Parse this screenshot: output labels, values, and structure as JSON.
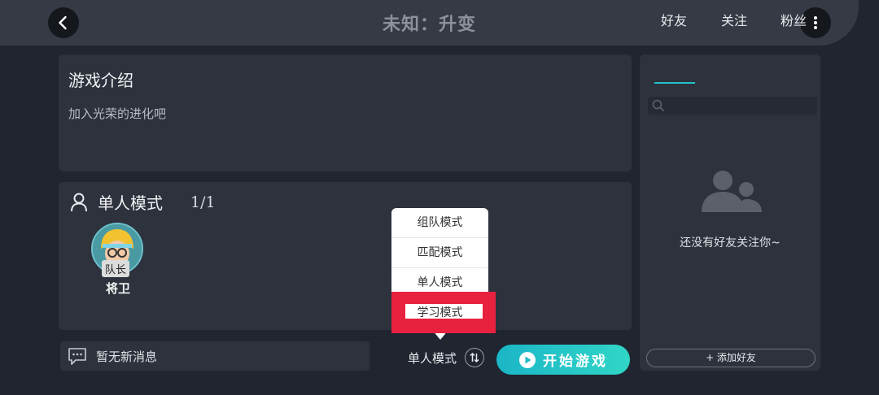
{
  "header": {
    "title": "未知：升变"
  },
  "intro": {
    "title": "游戏介绍",
    "text": "加入光荣的进化吧"
  },
  "mode_panel": {
    "mode_name": "单人模式",
    "player_count": "1/1",
    "member": {
      "badge": "队长",
      "name": "将卫"
    }
  },
  "dropdown": {
    "options": [
      "组队模式",
      "匹配模式",
      "单人模式",
      "学习模式"
    ],
    "highlighted_index": 3
  },
  "bottom": {
    "message": "暂无新消息",
    "current_mode": "单人模式",
    "start_label": "开始游戏"
  },
  "friends": {
    "tabs": [
      "好友",
      "关注",
      "粉丝"
    ],
    "active_tab": "好友",
    "empty_text": "还没有好友关注你~",
    "add_button": "+ 添加好友"
  },
  "colors": {
    "accent": "#20c4c8",
    "highlight": "#e8213f",
    "background": "#202530",
    "panel": "#2d323d"
  }
}
